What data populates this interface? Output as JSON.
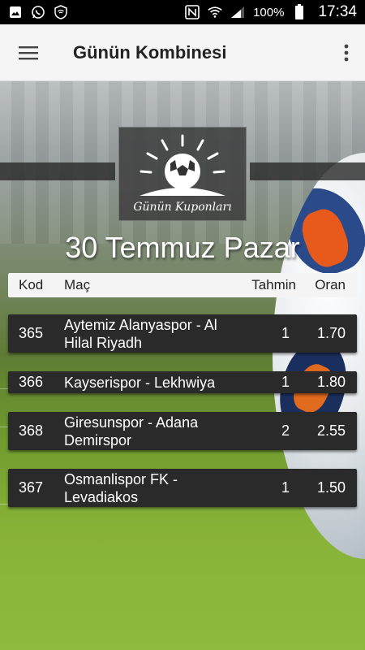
{
  "status_bar": {
    "battery_percent": "100%",
    "time": "17:34",
    "left_icons": [
      "image-icon",
      "whatsapp-icon",
      "wifi-shield-icon"
    ],
    "right_icons": [
      "nfc-icon",
      "wifi-icon",
      "signal-icon",
      "battery-icon"
    ]
  },
  "app_bar": {
    "title": "Günün Kombinesi",
    "menu_icon": "hamburger-menu-icon",
    "more_icon": "more-vert-icon"
  },
  "banner": {
    "logo_text": "Günün Kuponları",
    "date": "30 Temmuz Pazar"
  },
  "table": {
    "headers": {
      "kod": "Kod",
      "mac": "Maç",
      "tahmin": "Tahmin",
      "oran": "Oran"
    },
    "rows": [
      {
        "kod": "365",
        "mac": "Aytemiz Alanyaspor - Al Hilal Riyadh",
        "tahmin": "1",
        "oran": "1.70"
      },
      {
        "kod": "366",
        "mac": "Kayserispor - Lekhwiya",
        "tahmin": "1",
        "oran": "1.80"
      },
      {
        "kod": "368",
        "mac": "Giresunspor - Adana Demirspor",
        "tahmin": "2",
        "oran": "2.55"
      },
      {
        "kod": "367",
        "mac": "Osmanlispor FK - Levadiakos",
        "tahmin": "1",
        "oran": "1.50"
      }
    ]
  },
  "colors": {
    "app_bar_bg": "#f5f5f5",
    "row_bg": "#2a2a2a",
    "header_bg": "#f4f4f4"
  }
}
